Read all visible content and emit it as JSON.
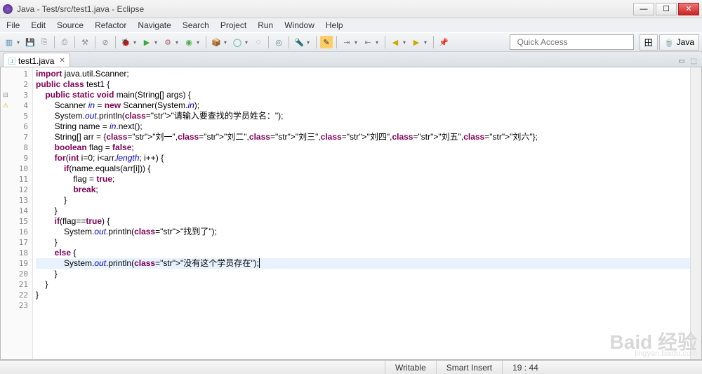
{
  "window": {
    "title": "Java - Test/src/test1.java - Eclipse"
  },
  "menu": [
    "File",
    "Edit",
    "Source",
    "Refactor",
    "Navigate",
    "Search",
    "Project",
    "Run",
    "Window",
    "Help"
  ],
  "quick_access": {
    "placeholder": "Quick Access"
  },
  "perspectives": {
    "open_label": "",
    "java_label": "Java"
  },
  "tab": {
    "label": "test1.java",
    "close": "✕"
  },
  "code": {
    "lines": [
      {
        "n": 1,
        "mark": "",
        "raw": "import java.util.Scanner;"
      },
      {
        "n": 2,
        "mark": "",
        "raw": "public class test1 {"
      },
      {
        "n": 3,
        "mark": "fold",
        "raw": "    public static void main(String[] args) {"
      },
      {
        "n": 4,
        "mark": "warn",
        "raw": "        Scanner in = new Scanner(System.in);"
      },
      {
        "n": 5,
        "mark": "",
        "raw": "        System.out.println(\"请输入要查找的学员姓名：\");"
      },
      {
        "n": 6,
        "mark": "",
        "raw": "        String name = in.next();"
      },
      {
        "n": 7,
        "mark": "",
        "raw": "        String[] arr = {\"刘一\",\"刘二\",\"刘三\",\"刘四\",\"刘五\",\"刘六\"};"
      },
      {
        "n": 8,
        "mark": "",
        "raw": "        boolean flag = false;"
      },
      {
        "n": 9,
        "mark": "",
        "raw": "        for(int i=0; i<arr.length; i++) {"
      },
      {
        "n": 10,
        "mark": "",
        "raw": "            if(name.equals(arr[i])) {"
      },
      {
        "n": 11,
        "mark": "",
        "raw": "                flag = true;"
      },
      {
        "n": 12,
        "mark": "",
        "raw": "                break;"
      },
      {
        "n": 13,
        "mark": "",
        "raw": "            }"
      },
      {
        "n": 14,
        "mark": "",
        "raw": "        }"
      },
      {
        "n": 15,
        "mark": "",
        "raw": "        if(flag==true) {"
      },
      {
        "n": 16,
        "mark": "",
        "raw": "            System.out.println(\"找到了\");"
      },
      {
        "n": 17,
        "mark": "",
        "raw": "        }"
      },
      {
        "n": 18,
        "mark": "",
        "raw": "        else {"
      },
      {
        "n": 19,
        "mark": "",
        "raw": "            System.out.println(\"没有这个学员存在\");|",
        "current": true
      },
      {
        "n": 20,
        "mark": "",
        "raw": "        }"
      },
      {
        "n": 21,
        "mark": "",
        "raw": "    }"
      },
      {
        "n": 22,
        "mark": "",
        "raw": "}"
      },
      {
        "n": 23,
        "mark": "",
        "raw": ""
      }
    ]
  },
  "status": {
    "writable": "Writable",
    "insert": "Smart Insert",
    "pos": "19 : 44"
  },
  "toolbar_icons": [
    "new",
    "save",
    "save-all",
    "sep",
    "print",
    "sep",
    "build",
    "sep",
    "skip-bp",
    "sep",
    "debug",
    "run",
    "external",
    "coverage",
    "sep",
    "new-pkg",
    "new-class",
    "new-iface",
    "sep",
    "open-type",
    "sep",
    "search",
    "sep",
    "toggle-mark",
    "sep",
    "next-ann",
    "prev-ann",
    "sep",
    "back",
    "forward",
    "sep",
    "pin"
  ],
  "watermark": {
    "main": "Baid 经验",
    "sub": "jingyan.baidu.com"
  }
}
